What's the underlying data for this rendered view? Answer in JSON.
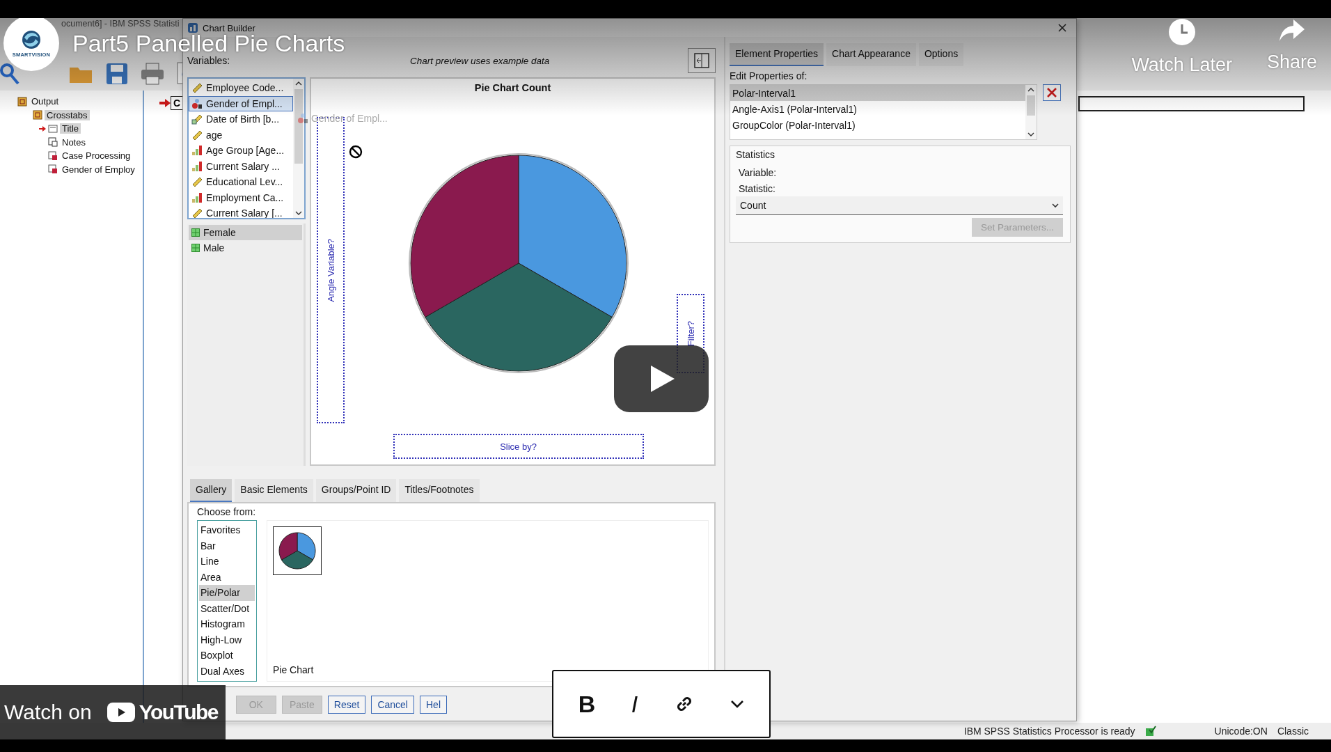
{
  "video": {
    "title": "Part5 Panelled Pie Charts",
    "logo_text": "SMARTVISION",
    "actions": [
      {
        "label": "Watch Later",
        "kind": "clock"
      },
      {
        "label": "Share",
        "kind": "share"
      }
    ],
    "watch_on": {
      "label": "Watch on",
      "brand": "YouTube"
    }
  },
  "app": {
    "title": "ocument6] - IBM SPSS Statisti",
    "pane_marker": "C",
    "tree": [
      {
        "label": "Output",
        "kind": "book",
        "selected": false,
        "children": [
          {
            "label": "Crosstabs",
            "kind": "book",
            "selected": true,
            "children": [
              {
                "label": "Title",
                "kind": "title",
                "selected": true,
                "current": true
              },
              {
                "label": "Notes",
                "kind": "notes",
                "selected": false,
                "current": false
              },
              {
                "label": "Case Processing",
                "kind": "table",
                "selected": false,
                "current": false
              },
              {
                "label": "Gender of Employ",
                "kind": "table",
                "selected": false,
                "current": false
              }
            ]
          }
        ]
      }
    ],
    "status_bar": {
      "message": "IBM SPSS Statistics Processor is ready",
      "encoding": "Unicode:ON",
      "mode": "Classic"
    }
  },
  "dialog": {
    "title": "Chart Builder",
    "variables_label": "Variables:",
    "preview_note": "Chart preview uses example data",
    "variables": [
      {
        "label": "Employee Code...",
        "kind": "scale",
        "selected": false
      },
      {
        "label": "Gender of Empl...",
        "kind": "nominal",
        "selected": true
      },
      {
        "label": "Date of Birth [b...",
        "kind": "date",
        "selected": false
      },
      {
        "label": "age",
        "kind": "scale",
        "selected": false
      },
      {
        "label": "Age Group [Age...",
        "kind": "ordinal",
        "selected": false
      },
      {
        "label": "Current Salary ...",
        "kind": "ordinal",
        "selected": false
      },
      {
        "label": "Educational Lev...",
        "kind": "scale",
        "selected": false
      },
      {
        "label": "Employment Ca...",
        "kind": "ordinal",
        "selected": false
      },
      {
        "label": "Current Salary [...",
        "kind": "scale",
        "selected": false
      }
    ],
    "categories": [
      {
        "label": "Female",
        "selected": true
      },
      {
        "label": "Male",
        "selected": false
      }
    ],
    "canvas": {
      "title": "Pie Chart Count",
      "drag_ghost": "Gender of Empl...",
      "drop_zones": [
        {
          "label": "Angle Variable?",
          "kind": "angle"
        },
        {
          "label": "Slice by?",
          "kind": "slice"
        },
        {
          "label": "Filter?",
          "kind": "filter"
        }
      ]
    },
    "tabs": [
      {
        "label": "Gallery",
        "selected": true
      },
      {
        "label": "Basic Elements",
        "selected": false
      },
      {
        "label": "Groups/Point ID",
        "selected": false
      },
      {
        "label": "Titles/Footnotes",
        "selected": false
      }
    ],
    "choose_label": "Choose from:",
    "chart_types": [
      {
        "label": "Favorites",
        "selected": false
      },
      {
        "label": "Bar",
        "selected": false
      },
      {
        "label": "Line",
        "selected": false
      },
      {
        "label": "Area",
        "selected": false
      },
      {
        "label": "Pie/Polar",
        "selected": true
      },
      {
        "label": "Scatter/Dot",
        "selected": false
      },
      {
        "label": "Histogram",
        "selected": false
      },
      {
        "label": "High-Low",
        "selected": false
      },
      {
        "label": "Boxplot",
        "selected": false
      },
      {
        "label": "Dual Axes",
        "selected": false
      }
    ],
    "gallery_items": [
      {
        "label": "Pie Chart"
      }
    ],
    "buttons": [
      {
        "label": "OK",
        "disabled": true
      },
      {
        "label": "Paste",
        "disabled": true
      },
      {
        "label": "Reset",
        "disabled": false
      },
      {
        "label": "Cancel",
        "disabled": false
      },
      {
        "label": "Hel",
        "disabled": false
      }
    ],
    "properties": {
      "tabs": [
        {
          "label": "Element Properties",
          "selected": true
        },
        {
          "label": "Chart Appearance",
          "selected": false
        },
        {
          "label": "Options",
          "selected": false
        }
      ],
      "edit_label": "Edit Properties of:",
      "elements": [
        {
          "label": "Polar-Interval1",
          "selected": true
        },
        {
          "label": "Angle-Axis1 (Polar-Interval1)",
          "selected": false
        },
        {
          "label": "GroupColor (Polar-Interval1)",
          "selected": false
        }
      ],
      "statistics": {
        "title": "Statistics",
        "variable_label": "Variable:",
        "statistic_label": "Statistic:",
        "statistic": "Count",
        "set_parameters": {
          "label": "Set Parameters...",
          "disabled": true
        }
      }
    }
  },
  "format_toolbar": [
    {
      "kind": "bold",
      "label": "B"
    },
    {
      "kind": "italic",
      "label": "I"
    },
    {
      "kind": "link"
    },
    {
      "kind": "more"
    }
  ]
}
